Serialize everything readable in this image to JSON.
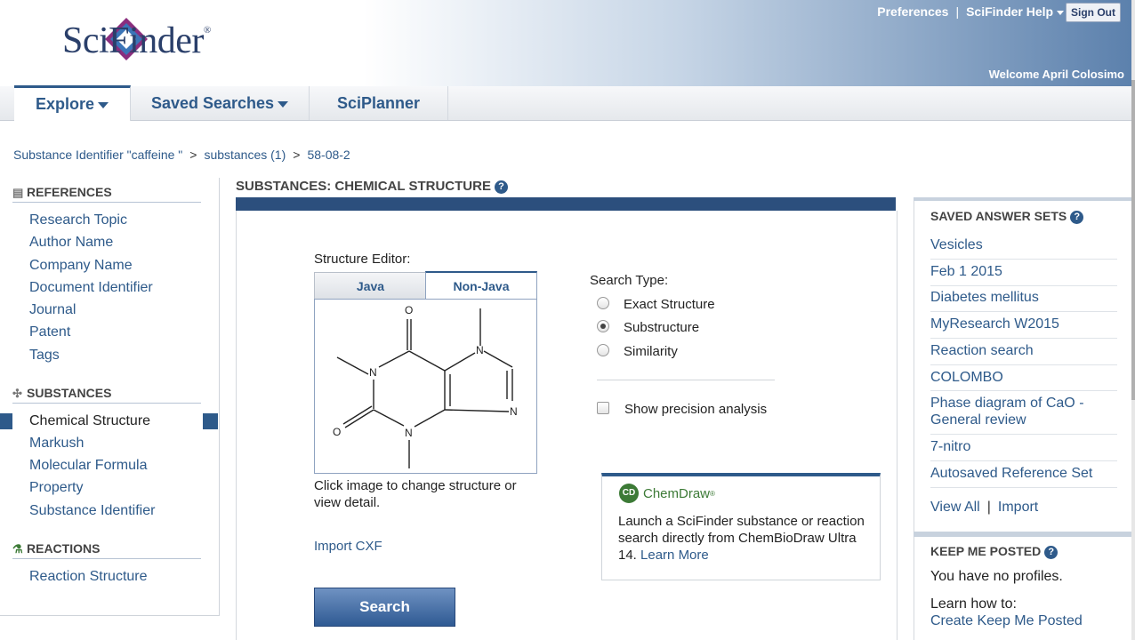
{
  "header": {
    "logo_text": "SciFinder",
    "logo_reg": "®",
    "preferences": "Preferences",
    "sep": "|",
    "help": "SciFinder Help",
    "sign_out": "Sign Out",
    "welcome": "Welcome April Colosimo"
  },
  "nav": {
    "tabs": [
      {
        "label": "Explore"
      },
      {
        "label": "Saved Searches"
      },
      {
        "label": "SciPlanner"
      }
    ]
  },
  "breadcrumb": {
    "items": [
      "Substance Identifier \"caffeine \"",
      "substances (1)",
      "58-08-2"
    ],
    "sep": ">"
  },
  "sidebar": {
    "references": {
      "heading": "REFERENCES",
      "items": [
        "Research Topic",
        "Author Name",
        "Company Name",
        "Document Identifier",
        "Journal",
        "Patent",
        "Tags"
      ]
    },
    "substances": {
      "heading": "SUBSTANCES",
      "items": [
        "Chemical Structure",
        "Markush",
        "Molecular Formula",
        "Property",
        "Substance Identifier"
      ]
    },
    "reactions": {
      "heading": "REACTIONS",
      "items": [
        "Reaction Structure"
      ]
    }
  },
  "main": {
    "title": "SUBSTANCES: CHEMICAL STRUCTURE",
    "help_glyph": "?",
    "editor_label": "Structure Editor:",
    "tab_java": "Java",
    "tab_nonjava": "Non-Java",
    "structure_atoms": {
      "o_top": "O",
      "n1": "N",
      "n7": "N",
      "n9": "N",
      "o_left": "O",
      "n3": "N"
    },
    "click_text": "Click image to change structure or view detail.",
    "import_cxf": "Import CXF",
    "search_button": "Search",
    "search_type_label": "Search Type:",
    "search_types": [
      {
        "label": "Exact Structure",
        "selected": false
      },
      {
        "label": "Substructure",
        "selected": true
      },
      {
        "label": "Similarity",
        "selected": false
      }
    ],
    "precision_label": "Show precision analysis",
    "chemdraw": {
      "badge": "CD",
      "name": "ChemDraw",
      "name_mark": "®",
      "text": "Launch a SciFinder substance or reaction search directly from ChemBioDraw Ultra 14.",
      "learn_more": "Learn More"
    }
  },
  "right": {
    "saved_heading": "SAVED ANSWER SETS",
    "saved_items": [
      "Vesicles",
      "Feb 1 2015",
      "Diabetes mellitus",
      "MyResearch W2015",
      "Reaction search",
      "COLOMBO",
      "Phase diagram of CaO - General review",
      "7-nitro",
      "Autosaved Reference Set"
    ],
    "view_all": "View All",
    "sep": "|",
    "import": "Import",
    "kmp_heading": "KEEP ME POSTED",
    "no_profiles": "You have no profiles.",
    "learn_how": "Learn how to:",
    "create_kmp": "Create Keep Me Posted"
  },
  "colors": {
    "brand": "#2e5a8a",
    "bar": "#2c4f7d",
    "chemdraw": "#3c7a36"
  }
}
